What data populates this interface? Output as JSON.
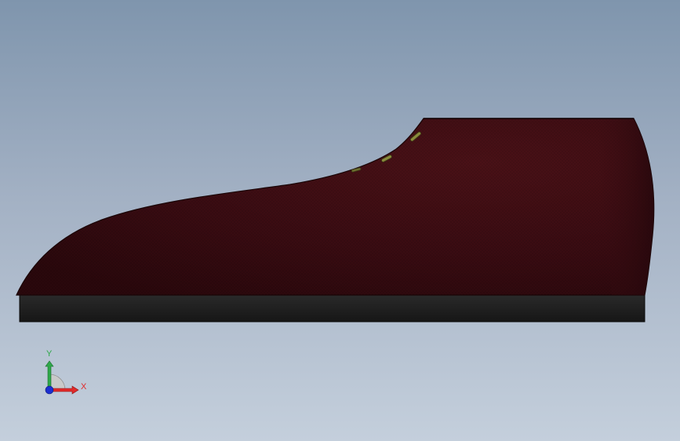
{
  "viewport": {
    "background_top": "#7f95ad",
    "background_bottom": "#c4cfdc"
  },
  "model": {
    "upper_color": "#3b0d12",
    "sole_color": "#1e1e1e",
    "eyelet_color": "#8a8a3c"
  },
  "triad": {
    "y_label": "Y",
    "x_label": "X",
    "y_color": "#2fa84a",
    "x_color": "#e02a2a",
    "z_color": "#1c2fd0"
  }
}
